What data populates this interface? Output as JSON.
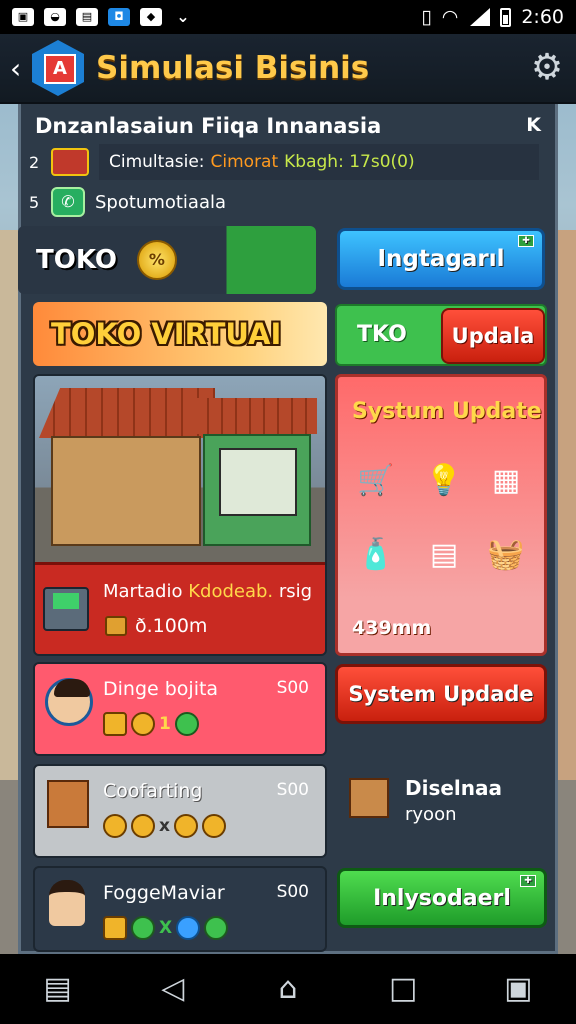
{
  "status_bar": {
    "time": "2:60"
  },
  "header": {
    "title": "Simulasi Bisinis"
  },
  "panel": {
    "title": "Dnzanlasaiun Fiiqa Innanasia",
    "close_label": "K",
    "info_rows": [
      {
        "num": "2",
        "label": "Cimultasie:",
        "highlight": "Cimorat",
        "extra": "Kbagh: 17s0(0)"
      },
      {
        "num": "5",
        "label": "Spotumotiaala"
      }
    ]
  },
  "toko_card": {
    "label": "TOKO",
    "coin_text": "%"
  },
  "top_button": {
    "label": "Ingtagarıl"
  },
  "banner": {
    "label": "TOKO VIRTUAI"
  },
  "tko_box": {
    "label": "TKO",
    "update_label": "Updala"
  },
  "shop_card": {
    "name": "Martadio",
    "name_highlight": "Kdodeab.",
    "name_suffix": "rsig",
    "price": "ð.100m"
  },
  "system_update_card": {
    "title": "Systum Update",
    "amount": "439mm",
    "icons": [
      "cart-icon",
      "bulb-icon",
      "shelf-icon",
      "bottle-icon",
      "register-icon",
      "basket-icon"
    ]
  },
  "rows": [
    {
      "name": "Dinge bojita",
      "value": "S00",
      "chips_text": "1"
    },
    {
      "name": "Coofarting",
      "value": "S00",
      "chips_text": "x"
    },
    {
      "name": "FoggeMaviar",
      "value": "S00",
      "chips_text": "X"
    }
  ],
  "system_update_button": {
    "label": "System Updade"
  },
  "distributor": {
    "name": "Diselnaa",
    "sub": "ryoon"
  },
  "green_button": {
    "label": "Inlysodaerl"
  },
  "colors": {
    "accent_gold": "#ffc94a",
    "panel": "#2d3a48",
    "red": "#c92a22",
    "green": "#3ec14e",
    "blue": "#1a7ad6"
  }
}
